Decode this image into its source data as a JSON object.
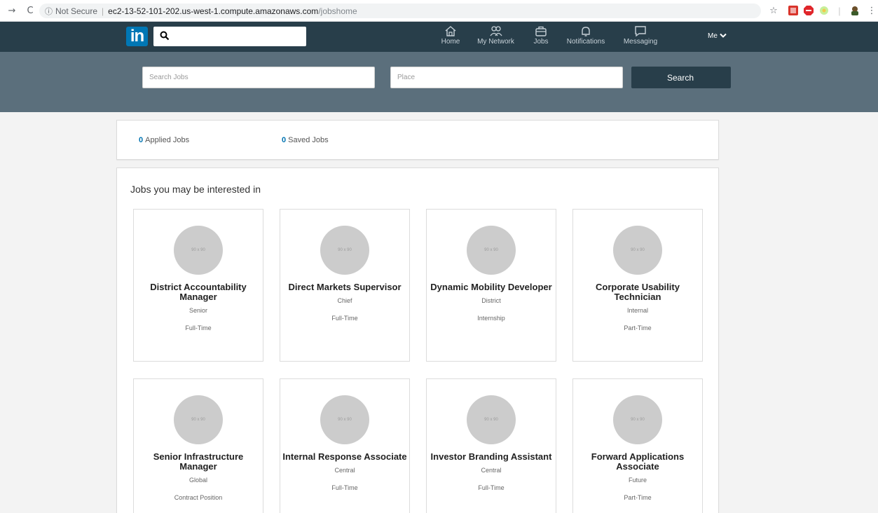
{
  "browser": {
    "back_icon": "→",
    "reload_icon": "C",
    "info_icon": "ⓘ",
    "security_label": "Not Secure",
    "separator": "|",
    "url_host": "ec2-13-52-101-202.us-west-1.compute.amazonaws.com",
    "url_path": "/jobshome",
    "star_icon": "☆",
    "menu_icon": "⋮"
  },
  "nav": {
    "logo": "in",
    "items": [
      {
        "label": "Home",
        "icon": "home-icon"
      },
      {
        "label": "My Network",
        "icon": "network-icon"
      },
      {
        "label": "Jobs",
        "icon": "briefcase-icon"
      },
      {
        "label": "Notifications",
        "icon": "bell-icon"
      },
      {
        "label": "Messaging",
        "icon": "message-icon"
      }
    ],
    "me_label": "Me"
  },
  "search": {
    "jobs_placeholder": "Search Jobs",
    "place_placeholder": "Place",
    "button_label": "Search"
  },
  "stats": {
    "applied_count": "0",
    "applied_label": "Applied Jobs",
    "saved_count": "0",
    "saved_label": "Saved Jobs"
  },
  "jobs": {
    "heading": "Jobs you may be interested in",
    "thumb_text": "90 x 90",
    "items": [
      {
        "title": "District Accountability Manager",
        "level": "Senior",
        "type": "Full-Time"
      },
      {
        "title": "Direct Markets Supervisor",
        "level": "Chief",
        "type": "Full-Time"
      },
      {
        "title": "Dynamic Mobility Developer",
        "level": "District",
        "type": "Internship"
      },
      {
        "title": "Corporate Usability Technician",
        "level": "Internal",
        "type": "Part-Time"
      },
      {
        "title": "Senior Infrastructure Manager",
        "level": "Global",
        "type": "Contract Position"
      },
      {
        "title": "Internal Response Associate",
        "level": "Central",
        "type": "Full-Time"
      },
      {
        "title": "Investor Branding Assistant",
        "level": "Central",
        "type": "Full-Time"
      },
      {
        "title": "Forward Applications Associate",
        "level": "Future",
        "type": "Part-Time"
      }
    ]
  },
  "colors": {
    "navbar": "#283e4a",
    "banner": "#5b6f7c",
    "brand": "#0077b5",
    "link": "#0073b1"
  }
}
